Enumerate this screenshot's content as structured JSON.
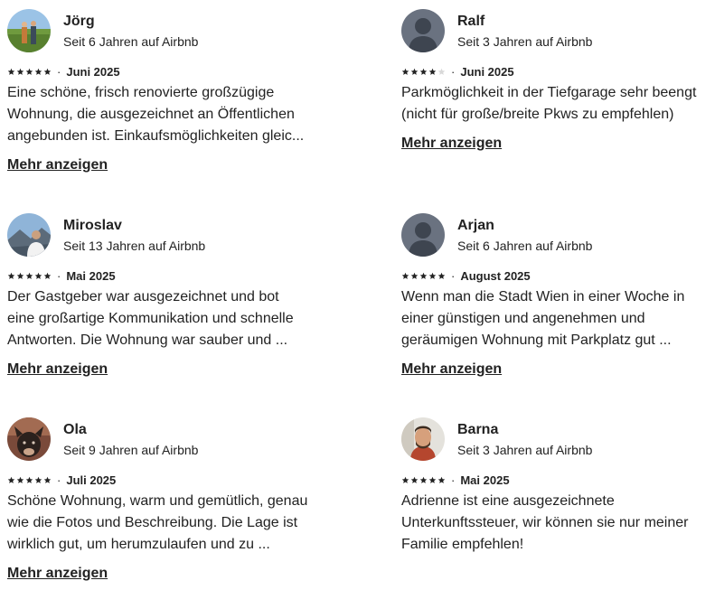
{
  "show_more_label": "Mehr anzeigen",
  "reviews": [
    {
      "name": "Jörg",
      "since": "Seit 6 Jahren auf Airbnb",
      "rating": 5,
      "separator": "·",
      "date": "Juni 2025",
      "text": "Eine schöne, frisch renovierte  großzügige\nWohnung,  die ausgezeichnet an Öffentlichen\nangebunden ist.  Einkaufsmöglichkeiten gleic...",
      "avatar": "photo-outdoor-couple"
    },
    {
      "name": "Ralf",
      "since": "Seit 3 Jahren auf Airbnb",
      "rating": 4,
      "separator": "·",
      "date": "Juni 2025",
      "text": "Parkmöglichkeit in der Tiefgarage sehr beengt\n(nicht für große/breite Pkws zu empfehlen)",
      "avatar": "default-user-icon"
    },
    {
      "name": "Miroslav",
      "since": "Seit 13 Jahren auf Airbnb",
      "rating": 5,
      "separator": "·",
      "date": "Mai 2025",
      "text": "Der Gastgeber war ausgezeichnet und bot\neine großartige Kommunikation und schnelle\nAntworten. Die Wohnung war sauber und ...",
      "avatar": "photo-mountain-selfie"
    },
    {
      "name": "Arjan",
      "since": "Seit 6 Jahren auf Airbnb",
      "rating": 5,
      "separator": "·",
      "date": "August 2025",
      "text": "Wenn man die Stadt Wien in einer Woche in\neiner günstigen und angenehmen und\ngeräumigen Wohnung mit Parkplatz gut ...",
      "avatar": "default-user-icon"
    },
    {
      "name": "Ola",
      "since": "Seit 9 Jahren auf Airbnb",
      "rating": 5,
      "separator": "·",
      "date": "Juli 2025",
      "text": "Schöne Wohnung, warm und gemütlich, genau\nwie die Fotos und Beschreibung. Die Lage ist\nwirklich gut, um herumzulaufen und zu ...",
      "avatar": "photo-dog"
    },
    {
      "name": "Barna",
      "since": "Seit 3 Jahren auf Airbnb",
      "rating": 5,
      "separator": "·",
      "date": "Mai 2025",
      "text": "Adrienne ist eine ausgezeichnete\nUnterkunftssteuer, wir können sie nur meiner\nFamilie empfehlen!",
      "avatar": "photo-man-portrait"
    }
  ]
}
